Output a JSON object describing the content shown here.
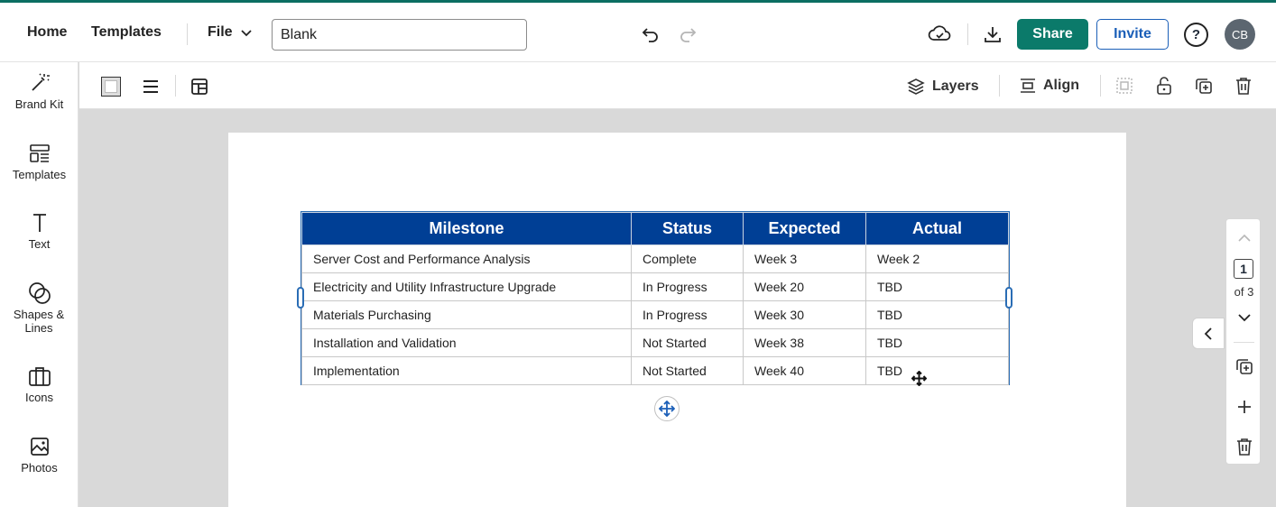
{
  "topbar": {
    "home": "Home",
    "templates": "Templates",
    "file": "File",
    "doc_title": "Blank",
    "share": "Share",
    "invite": "Invite",
    "help": "?",
    "avatar_initials": "CB"
  },
  "sidebar": {
    "items": [
      {
        "label": "Brand Kit",
        "icon": "magic-wand-icon"
      },
      {
        "label": "Templates",
        "icon": "templates-icon"
      },
      {
        "label": "Text",
        "icon": "text-icon"
      },
      {
        "label": "Shapes & Lines",
        "icon": "shapes-icon"
      },
      {
        "label": "Icons",
        "icon": "briefcase-icon"
      },
      {
        "label": "Photos",
        "icon": "image-icon"
      }
    ]
  },
  "toolbar": {
    "layers": "Layers",
    "align": "Align"
  },
  "table": {
    "headers": [
      "Milestone",
      "Status",
      "Expected",
      "Actual"
    ],
    "rows": [
      [
        "Server Cost and Performance Analysis",
        "Complete",
        "Week 3",
        "Week 2"
      ],
      [
        "Electricity and Utility Infrastructure Upgrade",
        "In Progress",
        "Week 20",
        "TBD"
      ],
      [
        "Materials Purchasing",
        "In Progress",
        "Week 30",
        "TBD"
      ],
      [
        "Installation and Validation",
        "Not Started",
        "Week 38",
        "TBD"
      ],
      [
        "Implementation",
        "Not Started",
        "Week 40",
        "TBD"
      ]
    ]
  },
  "pager": {
    "current": "1",
    "of_label": "of 3"
  },
  "colors": {
    "brand_green": "#0b7a6a",
    "header_blue": "#003f95",
    "selection_blue": "#2a6db5"
  }
}
